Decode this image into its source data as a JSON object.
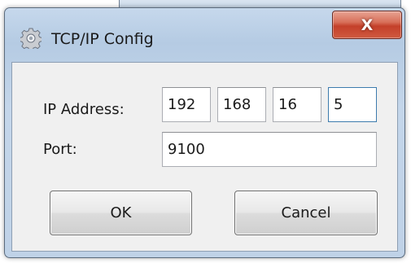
{
  "window": {
    "title": "TCP/IP Config",
    "close_label": "X"
  },
  "form": {
    "ip_label": "IP Address:",
    "ip_octets": [
      "192",
      "168",
      "16",
      "5"
    ],
    "port_label": "Port:",
    "port_value": "9100"
  },
  "buttons": {
    "ok_label": "OK",
    "cancel_label": "Cancel"
  },
  "colors": {
    "title_bar": "#bfd2e7",
    "close_button": "#c4402a",
    "client_bg": "#f0f0f0"
  },
  "icons": {
    "app_icon": "gear-icon",
    "close_icon": "close-icon"
  }
}
